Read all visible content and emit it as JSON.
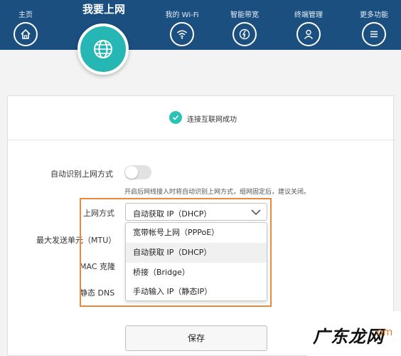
{
  "nav": {
    "home": "主页",
    "internet": "我要上网",
    "wifi": "我的 Wi-Fi",
    "bandwidth": "智能带宽",
    "devices": "终端管理",
    "more": "更多功能"
  },
  "status": {
    "text": "连接互联网成功",
    "color": "#2cc2b6"
  },
  "form": {
    "auto_detect_label": "自动识别上网方式",
    "auto_detect_hint": "开启后网线接入时将自动识别上网方式，组网固定后，建议关闭。",
    "auto_detect_on": false,
    "wan_mode_label": "上网方式",
    "wan_mode_value": "自动获取 IP（DHCP）",
    "mtu_label": "最大发送单元（MTU）",
    "mac_clone_label": "MAC 克隆",
    "static_dns_label": "静态 DNS",
    "save_label": "保存"
  },
  "dropdown": {
    "options": [
      "宽带帐号上网（PPPoE）",
      "自动获取 IP（DHCP）",
      "桥接（Bridge）",
      "手动输入 IP（静态IP）"
    ],
    "highlighted_index": 1
  },
  "watermark": {
    "logo_text": "广东龙网",
    "suffix": "om"
  },
  "colors": {
    "nav_bg": "#1b4f80",
    "accent": "#26b6b4",
    "highlight_border": "#e88a3a"
  }
}
